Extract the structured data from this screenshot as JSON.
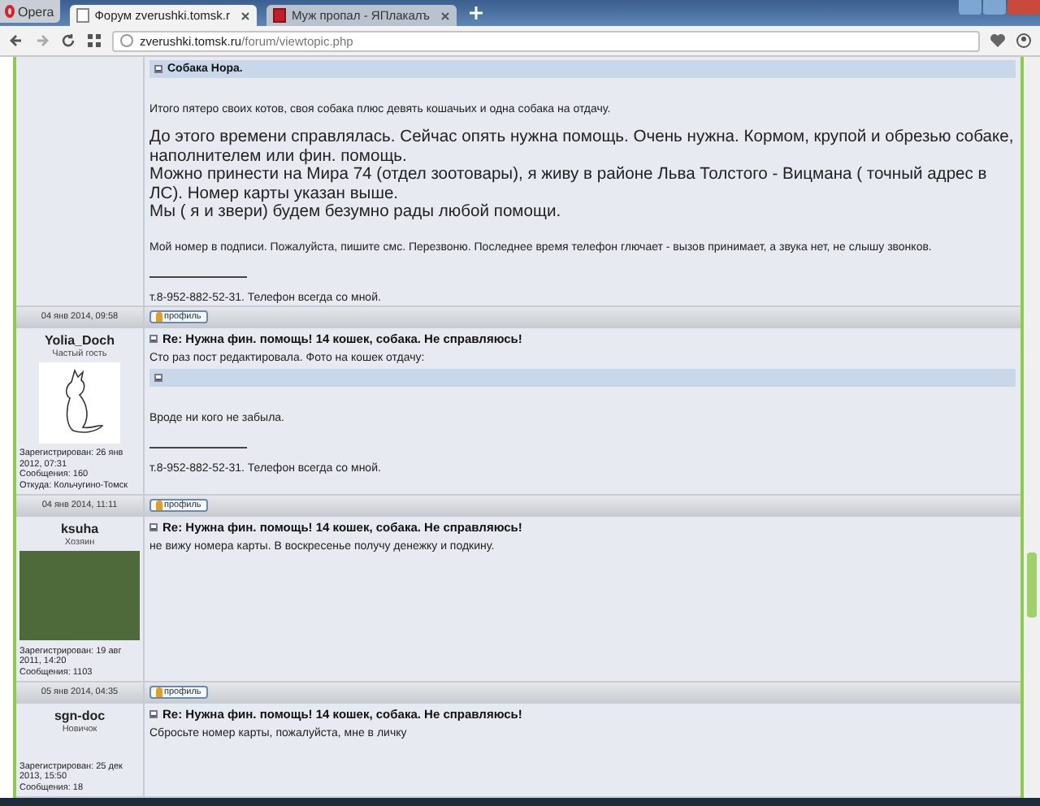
{
  "browser": {
    "menu": "Opera",
    "tabs": [
      {
        "label": "Форум zverushki.tomsk.r",
        "selected": true
      },
      {
        "label": "Муж пропал - ЯПлакалъ",
        "selected": false
      }
    ],
    "address": {
      "host": "zverushki.tomsk.ru",
      "path": "/forum/viewtopic.php"
    }
  },
  "posts": [
    {
      "body": [
        {
          "kind": "spoiler",
          "text": "Собака Нора."
        },
        {
          "kind": "small",
          "text": "Итого пятеро своих котов, своя собака плюс девять кошачьих и одна собака на отдачу."
        },
        {
          "kind": "large",
          "text": "До этого времени справлялась. Сейчас опять нужна помощь. Очень нужна. Кормом, крупой и обрезью собаке, наполнителем или фин. помощь.\nМожно принести на Мира 74 (отдел зоотовары), я живу в районе Льва Толстого - Вицмана ( точный адрес в ЛС). Номер карты указан выше.\nМы ( я и звери) будем безумно рады любой помощи."
        },
        {
          "kind": "small",
          "text": "Мой номер в подписи. Пожалуйста, пишите смс. Перезвоню. Последнее время телефон глючает - вызов принимает, а звука нет, не слышу звонков."
        }
      ],
      "signature": "т.8-952-882-52-31. Телефон всегда со мной.",
      "date": "04 янв 2014, 09:58",
      "profile": "профиль"
    },
    {
      "author": "Yolia_Doch",
      "rank": "Частый гость",
      "avatar": {
        "kind": "drawing"
      },
      "details": [
        "Зарегистрирован: 26 янв 2012, 07:31",
        "Сообщения: 160",
        "Откуда: Кольчугино-Томск"
      ],
      "title": "Re: Нужна фин. помощь! 14 кошек, собака. Не справляюсь!",
      "body": [
        {
          "kind": "small",
          "text": "Сто раз пост редактировала. Фото на кошек отдачу:"
        },
        {
          "kind": "spoiler"
        },
        {
          "kind": "small",
          "text": "Вроде ни кого не забыла."
        }
      ],
      "signature": "т.8-952-882-52-31. Телефон всегда со мной.",
      "date": "04 янв 2014, 11:11",
      "profile": "профиль"
    },
    {
      "author": "ksuha",
      "rank": "Хозяин",
      "avatar": {
        "kind": "photo"
      },
      "details": [
        "Зарегистрирован: 19 авг 2011, 14:20",
        "Сообщения: 1103"
      ],
      "title": "Re: Нужна фин. помощь! 14 кошек, собака. Не справляюсь!",
      "body": [
        {
          "kind": "small",
          "text": "не вижу номера карты. В воскресенье получу денежку и подкину."
        }
      ],
      "date": "05 янв 2014, 04:35",
      "profile": "профиль"
    },
    {
      "author": "sgn-doc",
      "rank": "Новичок",
      "details": [
        "Зарегистрирован: 25 дек 2013, 15:50",
        "Сообщения: 18"
      ],
      "title": "Re: Нужна фин. помощь! 14 кошек, собака. Не справляюсь!",
      "body": [
        {
          "kind": "small",
          "text": "Сбросьте номер карты, пожалуйста, мне в личку"
        }
      ]
    }
  ]
}
